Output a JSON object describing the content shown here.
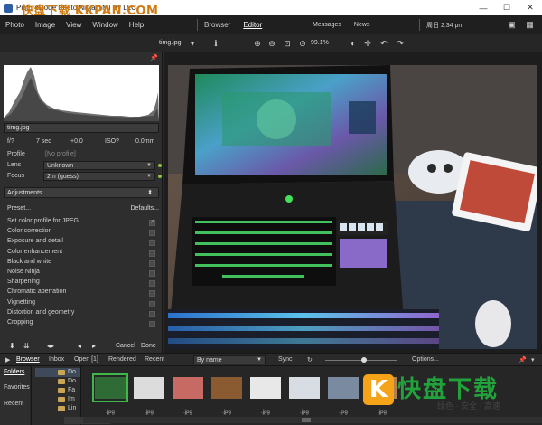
{
  "window": {
    "title": "PictureCode Photo Ninja(TM) By LLC",
    "watermark_top": "快盘下载 KKPAN.COM",
    "controls": [
      "—",
      "☐",
      "✕"
    ]
  },
  "menu": {
    "items": [
      "Photo",
      "Image",
      "View",
      "Window",
      "Help"
    ],
    "modes": [
      "Browser",
      "Editor"
    ],
    "active_mode": "Editor",
    "messages": "Messages",
    "news": "News",
    "clock": "周日 2:34 pm"
  },
  "image_toolbar": {
    "filename": "timg.jpg",
    "zoom": "99.1%"
  },
  "left_panel": {
    "filename": "timg.jpg",
    "exif": {
      "aperture": "f/?",
      "shutter": "7 sec",
      "ev": "+0.0",
      "iso": "ISO?",
      "focal": "0.0mm"
    },
    "profile": {
      "label": "Profile",
      "value": "[No profile]"
    },
    "lens": {
      "label": "Lens",
      "value": "Unknown"
    },
    "focus": {
      "label": "Focus",
      "value": "2m (guess)"
    },
    "adjustments_header": "Adjustments",
    "presets_label": "Preset...",
    "defaults_label": "Defaults...",
    "adjustments": [
      {
        "label": "Set color profile for JPEG",
        "checked": true
      },
      {
        "label": "Color correction",
        "checked": false
      },
      {
        "label": "Exposure and detail",
        "checked": false
      },
      {
        "label": "Color enhancement",
        "checked": false
      },
      {
        "label": "Black and white",
        "checked": false
      },
      {
        "label": "Noise Ninja",
        "checked": false
      },
      {
        "label": "Sharpening",
        "checked": false
      },
      {
        "label": "Chromatic aberration",
        "checked": false
      },
      {
        "label": "Vignetting",
        "checked": false
      },
      {
        "label": "Distortion and geometry",
        "checked": false
      },
      {
        "label": "Cropping",
        "checked": false
      }
    ],
    "cancel_label": "Cancel",
    "done_label": "Done"
  },
  "browser_bar": {
    "tabs": [
      "Browser",
      "Inbox",
      "Open [1]",
      "Rendered",
      "Recent"
    ],
    "active_tab": "Browser",
    "sort": "By name",
    "sync": "Sync",
    "options": "Options..."
  },
  "filmstrip": {
    "nav": [
      "Folders",
      "Favorites",
      "Recent"
    ],
    "active_nav": "Folders",
    "folders": [
      "Do",
      "Do",
      "Fa",
      "Im",
      "Lin"
    ],
    "thumbs": [
      {
        "caption": ".jpg",
        "selected": true,
        "color": "#2f6b35"
      },
      {
        "caption": ".jpg",
        "selected": false,
        "color": "#dcdcdc"
      },
      {
        "caption": ".jpg",
        "selected": false,
        "color": "#c86a64"
      },
      {
        "caption": ".jpg",
        "selected": false,
        "color": "#8a5a30"
      },
      {
        "caption": ".jpg",
        "selected": false,
        "color": "#e8e8e8"
      },
      {
        "caption": ".jpg",
        "selected": false,
        "color": "#d8dde4"
      },
      {
        "caption": ".jpg",
        "selected": false,
        "color": "#7a8aa0"
      },
      {
        "caption": ".jpg",
        "selected": false,
        "color": "#b08050"
      }
    ]
  },
  "watermark": {
    "logo_letter": "K",
    "title": "快盘下载",
    "subtitle": "绿色 · 安全 · 高速"
  }
}
